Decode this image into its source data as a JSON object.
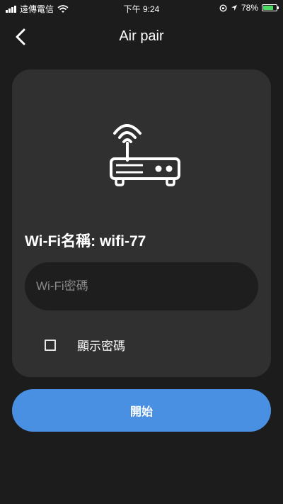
{
  "status_bar": {
    "carrier": "遠傳電信",
    "time": "下午 9:24",
    "battery": "78%",
    "battery_level": 0.78,
    "battery_color": "#4cd964"
  },
  "header": {
    "back_icon": "chevron-left-icon",
    "title": "Air pair"
  },
  "card": {
    "router_icon": "wifi-router-icon",
    "wifi_name_label": "Wi-Fi名稱: wifi-77",
    "password_placeholder": "Wi-Fi密碼",
    "password_value": "",
    "show_password_label": "顯示密碼",
    "show_password_checked": false
  },
  "start_button": {
    "label": "開始",
    "color": "#4a90e2"
  },
  "colors": {
    "background": "#1c1c1c",
    "card": "#303030",
    "input": "#1e1e1e"
  }
}
